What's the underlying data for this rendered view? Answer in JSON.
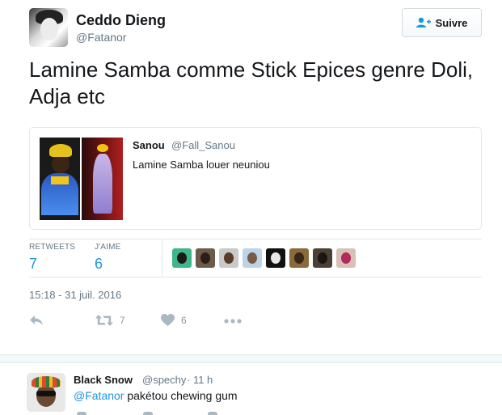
{
  "tweet": {
    "author_name": "Ceddo Dieng",
    "author_handle": "@Fatanor",
    "follow_label": "Suivre",
    "text": "Lamine Samba comme Stick Epices genre Doli, Adja etc",
    "quoted": {
      "author_name": "Sanou",
      "author_handle": "@Fall_Sanou",
      "text": "Lamine Samba louer neuniou"
    },
    "stats": {
      "retweets_label": "RETWEETS",
      "retweets_value": "7",
      "likes_label": "J'AIME",
      "likes_value": "6"
    },
    "timestamp": "15:18 - 31 juil. 2016",
    "actions": {
      "retweet_count": "7",
      "like_count": "6"
    }
  },
  "reply": {
    "author_name": "Black Snow",
    "author_handle": "@spechy",
    "time": "· 11 h",
    "mention": "@Fatanor",
    "text": " pakétou chewing gum"
  },
  "colors": {
    "link": "#1b95e0",
    "muted": "#657786",
    "border": "#e1e8ed"
  },
  "icons": [
    "add-user-icon",
    "reply-icon",
    "retweet-icon",
    "heart-icon",
    "more-icon"
  ]
}
